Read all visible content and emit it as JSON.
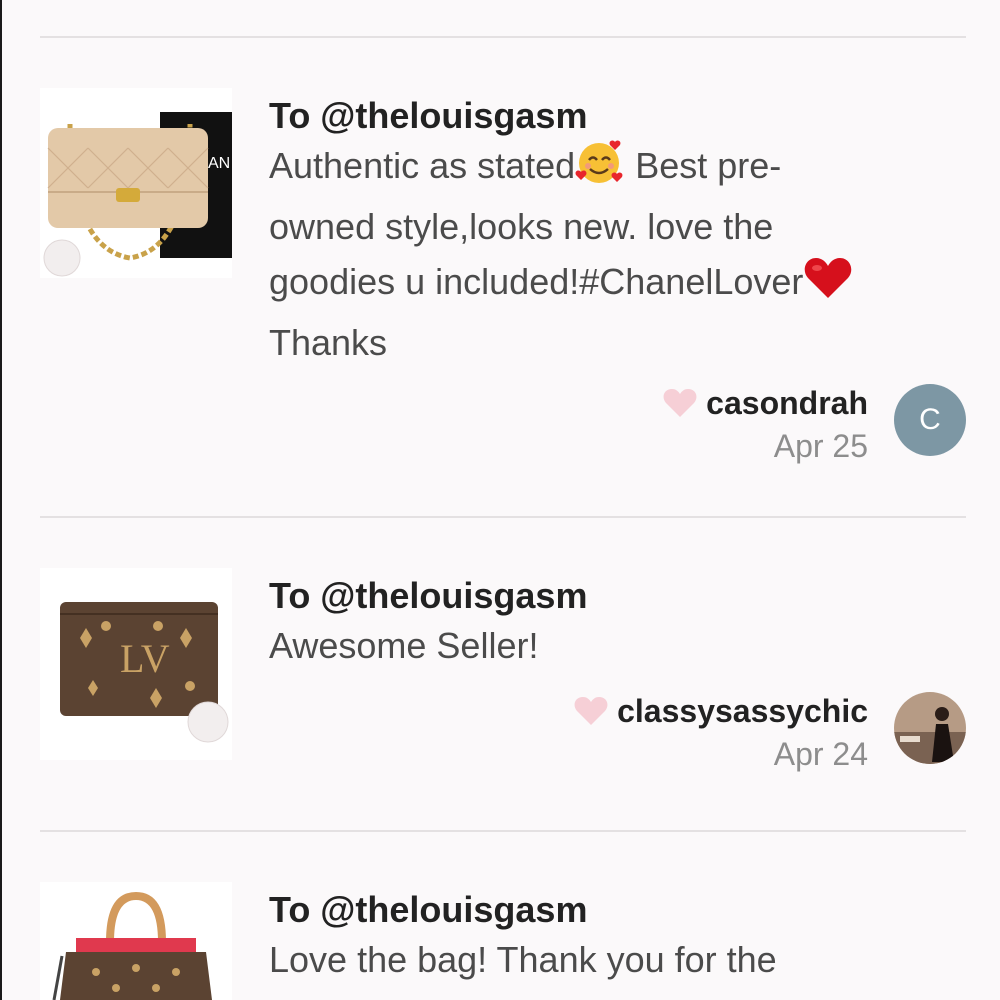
{
  "reviews": [
    {
      "to": "To @thelouisgasm",
      "lines": [
        "Authentic as stated",
        " Best pre-",
        "owned style,looks new. love the",
        "goodies u included!#ChanelLover",
        "Thanks"
      ],
      "username": "casondrah",
      "date": "Apr 25",
      "avatar_letter": "C",
      "product_icon": "chanel-flap-bag-icon",
      "emojis": [
        "smiling-face-with-hearts-icon",
        "red-heart-icon"
      ]
    },
    {
      "to": "To @thelouisgasm",
      "lines": [
        "Awesome Seller!"
      ],
      "username": "classysassychic",
      "date": "Apr 24",
      "product_icon": "lv-monogram-wallet-icon"
    },
    {
      "to": "To @thelouisgasm",
      "lines": [
        "Love the bag! Thank you for the"
      ],
      "product_icon": "lv-monogram-handbag-icon"
    }
  ],
  "colors": {
    "background": "#fbf9fa",
    "divider": "#e4e1e2",
    "heart_outline": "#f6cfd6",
    "avatar_bg": "#7d97a4",
    "date_text": "#8d8d8d"
  }
}
